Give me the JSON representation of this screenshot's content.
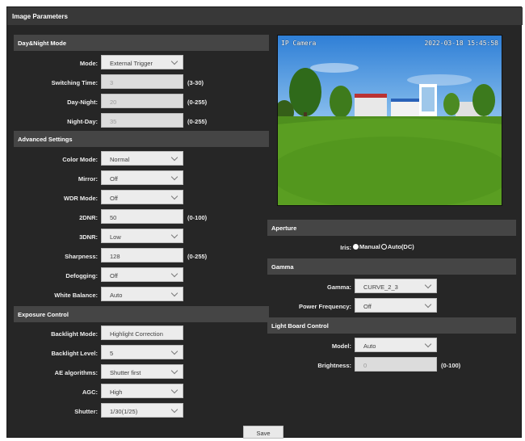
{
  "window": {
    "title": "Image Parameters"
  },
  "left": {
    "daynight": {
      "title": "Day&Night Mode",
      "rows": [
        {
          "label": "Mode:",
          "value": "External Trigger",
          "type": "select"
        },
        {
          "label": "Switching Time:",
          "value": "3",
          "type": "input-disabled",
          "range": "(3-30)"
        },
        {
          "label": "Day-Night:",
          "value": "20",
          "type": "input-disabled",
          "range": "(0-255)"
        },
        {
          "label": "Night-Day:",
          "value": "35",
          "type": "input-disabled",
          "range": "(0-255)"
        }
      ]
    },
    "advanced": {
      "title": "Advanced Settings",
      "rows": [
        {
          "label": "Color Mode:",
          "value": "Normal",
          "type": "select"
        },
        {
          "label": "Mirror:",
          "value": "Off",
          "type": "select"
        },
        {
          "label": "WDR Mode:",
          "value": "Off",
          "type": "select"
        },
        {
          "label": "2DNR:",
          "value": "50",
          "type": "input",
          "range": "(0-100)"
        },
        {
          "label": "3DNR:",
          "value": "Low",
          "type": "select"
        },
        {
          "label": "Sharpness:",
          "value": "128",
          "type": "input",
          "range": "(0-255)"
        },
        {
          "label": "Defogging:",
          "value": "Off",
          "type": "select"
        },
        {
          "label": "White Balance:",
          "value": "Auto",
          "type": "select"
        }
      ]
    },
    "exposure": {
      "title": "Exposure Control",
      "rows": [
        {
          "label": "Backlight Mode:",
          "value": "Highlight Correction",
          "type": "select"
        },
        {
          "label": "Backlight Level:",
          "value": "5",
          "type": "select"
        },
        {
          "label": "AE algorithms:",
          "value": "Shutter first",
          "type": "select"
        },
        {
          "label": "AGC:",
          "value": "High",
          "type": "select"
        },
        {
          "label": "Shutter:",
          "value": "1/30(1/25)",
          "type": "select"
        }
      ]
    }
  },
  "right": {
    "preview": {
      "osd_left": "IP Camera",
      "osd_right": "2022-03-18 15:45:58"
    },
    "aperture": {
      "title": "Aperture",
      "iris_label": "Iris:",
      "iris_options": [
        "Manual",
        "Auto(DC)"
      ],
      "iris_selected": "Manual"
    },
    "gamma": {
      "title": "Gamma",
      "rows": [
        {
          "label": "Gamma:",
          "value": "CURVE_2_3",
          "type": "select"
        },
        {
          "label": "Power Frequency:",
          "value": "Off",
          "type": "select"
        }
      ]
    },
    "lightboard": {
      "title": "Light Board Control",
      "rows": [
        {
          "label": "Model:",
          "value": "Auto",
          "type": "select"
        },
        {
          "label": "Brightness:",
          "value": "0",
          "type": "input-disabled",
          "range": "(0-100)"
        }
      ]
    }
  },
  "actions": {
    "save_label": "Save"
  },
  "colors": {
    "background": "#262626",
    "section": "#454545",
    "titlebar": "#383838",
    "field": "#ececec"
  }
}
